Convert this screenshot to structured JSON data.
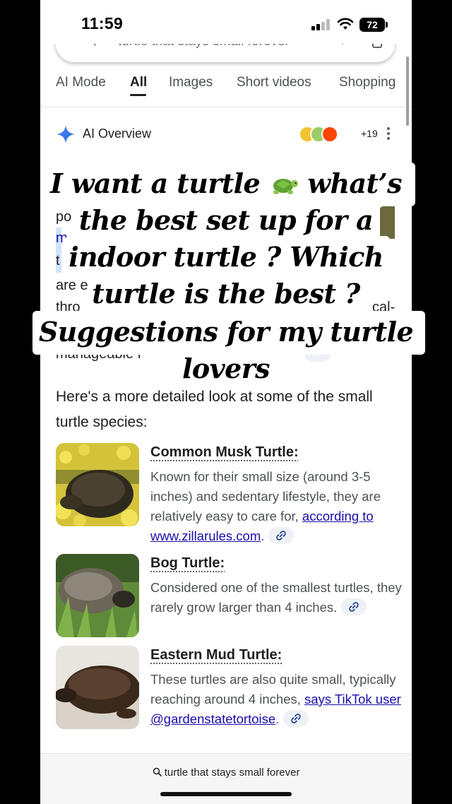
{
  "status_bar": {
    "time": "11:59",
    "battery": "72"
  },
  "search": {
    "query": "turtle that stays small forever"
  },
  "tabs": [
    {
      "label": "AI Mode",
      "active": false
    },
    {
      "label": "All",
      "active": true
    },
    {
      "label": "Images",
      "active": false
    },
    {
      "label": "Short videos",
      "active": false
    },
    {
      "label": "Shopping",
      "active": false
    }
  ],
  "ai_overview": {
    "title": "AI Overview",
    "source_count": "+19",
    "covered_fragments": [
      "po",
      "m",
      "t",
      "are e",
      "thro",
      "cal-",
      "manageable f"
    ]
  },
  "caption": {
    "line1_a": "I want a turtle",
    "line1_b": "what’s",
    "line2": "the best set up for a",
    "line3": "indoor turtle ? Which",
    "line4": "turtle is the best ?",
    "line5": "Suggestions for my turtle",
    "line6": "lovers"
  },
  "lead_text": "Here's a more detailed look at some of the small turtle species:",
  "species": [
    {
      "title": "Common Musk Turtle:",
      "body": "Known for their small size (around 3-5 inches) and sedentary lifestyle, they are relatively easy to care for,",
      "link": "according to www.zillarules.com",
      "after_link": "."
    },
    {
      "title": "Bog Turtle:",
      "body": "Considered one of the smallest turtles, they rarely grow larger than 4 inches.",
      "link": "",
      "after_link": ""
    },
    {
      "title": "Eastern Mud Turtle:",
      "body": "These turtles are also quite small, typically reaching around 4 inches,",
      "link": "says TikTok user @gardenstatetortoise",
      "after_link": "."
    }
  ],
  "bottom_bar": {
    "query": "turtle that stays small forever"
  },
  "colors": {
    "link": "#1a0dab",
    "accent_blue": "#4285f4",
    "text": "#1f1f1f"
  }
}
